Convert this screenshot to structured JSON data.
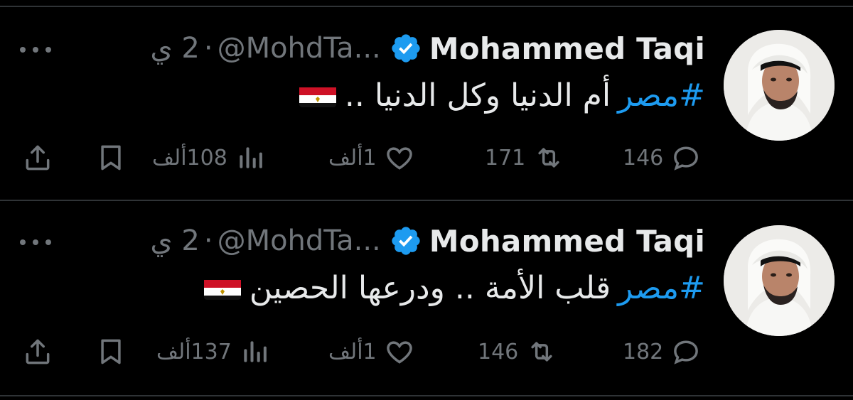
{
  "tweets": [
    {
      "author_name": "Mohammed Taqi",
      "handle": "@MohdTa...",
      "time": "2 ي",
      "separator": "·",
      "hashtag": "#مصر",
      "text": "أم الدنيا وكل الدنيا ..",
      "replies": "146",
      "reposts": "171",
      "likes": "1ألف",
      "views": "108ألف"
    },
    {
      "author_name": "Mohammed Taqi",
      "handle": "@MohdTa...",
      "time": "2 ي",
      "separator": "·",
      "hashtag": "#مصر",
      "text": "قلب الأمة .. ودرعها الحصين",
      "replies": "182",
      "reposts": "146",
      "likes": "1ألف",
      "views": "137ألف"
    }
  ],
  "colors": {
    "background": "#000000",
    "text_primary": "#e7e9ea",
    "text_secondary": "#71767b",
    "hashtag": "#1d9bf0",
    "verified_badge": "#1d9bf0",
    "divider": "#2f3336"
  }
}
